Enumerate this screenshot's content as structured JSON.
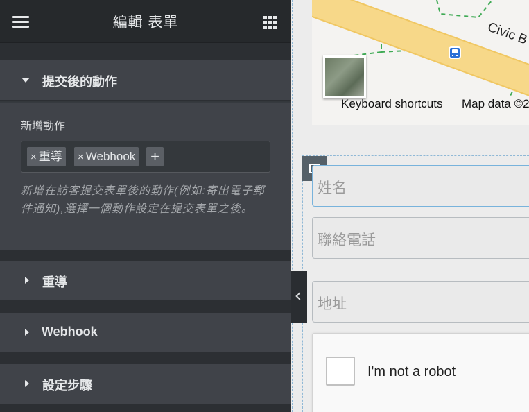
{
  "panel": {
    "title": "編輯 表單",
    "sections": {
      "actions_after_submit": {
        "label": "提交後的動作",
        "add_action_label": "新增動作",
        "tags": [
          "重導",
          "Webhook"
        ],
        "tag_remove_symbol": "×",
        "add_symbol": "+",
        "help_text": "新增在訪客提交表單後的動作(例如:寄出電子郵件通知),選擇一個動作設定在提交表單之後。"
      },
      "redirect": {
        "label": "重導"
      },
      "webhook": {
        "label": "Webhook"
      },
      "steps": {
        "label": "設定步驟"
      }
    }
  },
  "map": {
    "street_label": "Civic B",
    "keyboard_shortcuts": "Keyboard shortcuts",
    "map_data": "Map data ©2"
  },
  "form": {
    "name_placeholder": "姓名",
    "phone_placeholder": "聯絡電話",
    "address_placeholder": "地址",
    "captcha_label": "I'm not a robot"
  },
  "icons": {
    "menu": "hamburger-menu-icon",
    "apps": "grid-apps-icon",
    "collapse": "chevron-left-icon",
    "column": "column-handle-icon",
    "bus": "bus-stop-icon"
  },
  "colors": {
    "panel_bg": "#34383c",
    "header_bg": "#26292c",
    "section_bg": "#404349",
    "accent_border": "#78b3dc"
  }
}
